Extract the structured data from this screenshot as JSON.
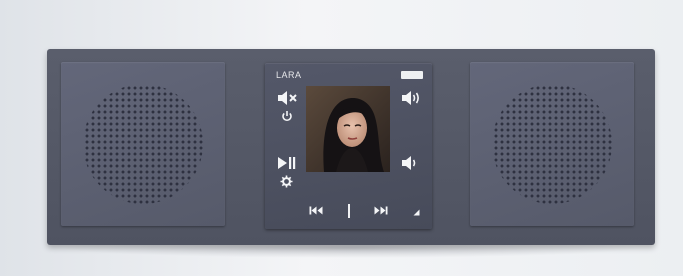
{
  "device": {
    "station_name": "LARA",
    "brand_logo": "brand-logo"
  },
  "controls": {
    "mute": "mute-icon",
    "power": "power-icon",
    "volume_up": "volume-up-icon",
    "play_pause": "play-pause-icon",
    "settings": "settings-icon",
    "volume_down": "volume-down-icon",
    "previous": "previous-track-icon",
    "next": "next-track-icon",
    "corner": "corner-arrow-icon"
  },
  "colors": {
    "frame": "#545869",
    "speaker": "#5c6072",
    "icon": "#f4f5f7",
    "wall": "#eceff2"
  }
}
